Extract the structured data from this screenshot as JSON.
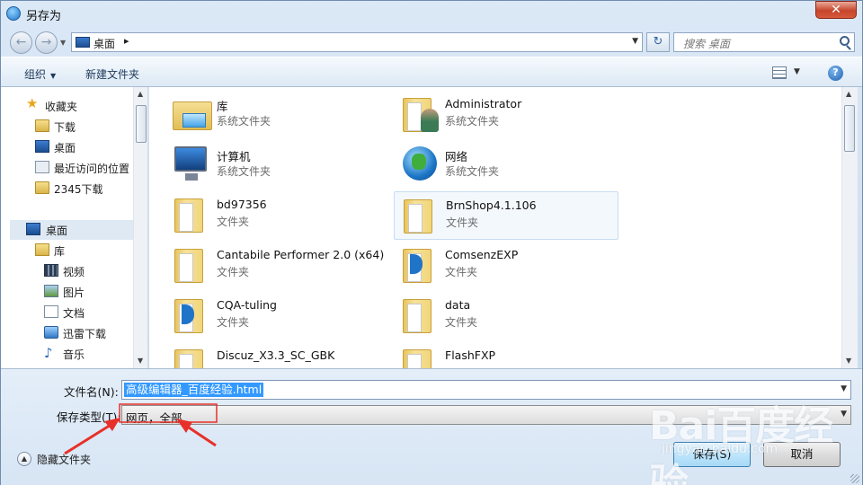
{
  "window": {
    "title": "另存为",
    "close_label": "✕"
  },
  "nav": {
    "back_glyph": "←",
    "forward_glyph": "→",
    "address_location": "桌面",
    "address_separator": "▸",
    "search_placeholder": "搜索 桌面"
  },
  "toolbar": {
    "organize": "组织",
    "new_folder": "新建文件夹",
    "help": "?"
  },
  "sidebar": {
    "items": [
      {
        "label": "收藏夹",
        "icon": "favorites-star-icon"
      },
      {
        "label": "下载",
        "icon": "downloads-folder-icon"
      },
      {
        "label": "桌面",
        "icon": "desktop-icon"
      },
      {
        "label": "最近访问的位置",
        "icon": "recent-places-icon"
      },
      {
        "label": "2345下载",
        "icon": "folder-icon"
      },
      {
        "label": "桌面",
        "icon": "desktop-icon"
      },
      {
        "label": "库",
        "icon": "libraries-icon"
      },
      {
        "label": "视频",
        "icon": "video-library-icon"
      },
      {
        "label": "图片",
        "icon": "pictures-library-icon"
      },
      {
        "label": "文档",
        "icon": "documents-library-icon"
      },
      {
        "label": "迅雷下载",
        "icon": "xunlei-download-icon"
      },
      {
        "label": "音乐",
        "icon": "music-library-icon"
      }
    ]
  },
  "files": [
    {
      "name": "库",
      "type": "系统文件夹",
      "icon": "library-icon"
    },
    {
      "name": "Administrator",
      "type": "系统文件夹",
      "icon": "user-folder-icon"
    },
    {
      "name": "计算机",
      "type": "系统文件夹",
      "icon": "computer-icon"
    },
    {
      "name": "网络",
      "type": "系统文件夹",
      "icon": "network-globe-icon"
    },
    {
      "name": "bd97356",
      "type": "文件夹",
      "icon": "folder-icon"
    },
    {
      "name": "BrnShop4.1.106",
      "type": "文件夹",
      "icon": "folder-icon"
    },
    {
      "name": "Cantabile Performer 2.0 (x64)",
      "type": "文件夹",
      "icon": "folder-icon"
    },
    {
      "name": "ComsenzEXP",
      "type": "文件夹",
      "icon": "folder-icon"
    },
    {
      "name": "CQA-tuling",
      "type": "文件夹",
      "icon": "folder-icon"
    },
    {
      "name": "data",
      "type": "文件夹",
      "icon": "folder-icon"
    },
    {
      "name": "Discuz_X3.3_SC_GBK",
      "type": "",
      "icon": "folder-icon"
    },
    {
      "name": "FlashFXP",
      "type": "",
      "icon": "folder-icon"
    }
  ],
  "form": {
    "filename_label": "文件名(N):",
    "filename_value": "高级编辑器_百度经验.html",
    "filetype_label": "保存类型(T):",
    "filetype_value": "网页，全部"
  },
  "footer": {
    "hide_folders": "隐藏文件夹",
    "save": "保存(S)",
    "cancel": "取消"
  },
  "watermark": {
    "brand": "Bai百度经验",
    "url": "jingyan.baidu.com"
  },
  "colors": {
    "selection": "#3399ff",
    "annotation_arrow": "#e8302a",
    "window_frame": "#6f8cb0"
  }
}
